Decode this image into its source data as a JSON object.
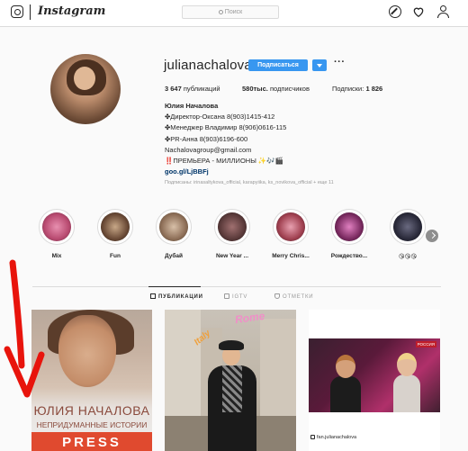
{
  "topbar": {
    "wordmark": "Instagram",
    "search_placeholder": "Поиск"
  },
  "profile": {
    "username": "julianachalova",
    "follow_label": "Подписаться",
    "more_label": "···",
    "stats": {
      "posts_value": "3 647",
      "posts_label": "публикаций",
      "followers_value": "580тыс.",
      "followers_label": "подписчиков",
      "following_label": "Подписки:",
      "following_value": "1 826"
    },
    "bio": {
      "full_name": "Юлия Началова",
      "line1": "✤Директор-Оксана 8(903)1415-412",
      "line2": "✤Менеджер Владимир 8(906)0616-115",
      "line3": "✤PR-Анна 8(903)6196-600",
      "line4": "Nachalovagroup@gmail.com",
      "line5": "‼️ПРЕМЬЕРА - МИЛЛИОНЫ ✨🎶🎬",
      "link": "goo.gl/LjBBFj"
    },
    "followed_by": "Подписаны: irinasaltykova_official, karapyiika, ks_novikova_official + еще 11"
  },
  "highlights": [
    {
      "label": "Mix",
      "color": "#b84a70"
    },
    {
      "label": "Fun",
      "color": "#6a4a36"
    },
    {
      "label": "Дубай",
      "color": "#8e6f58"
    },
    {
      "label": "New Year ...",
      "color": "#5a3a3a"
    },
    {
      "label": "Merry Chris...",
      "color": "#a04050"
    },
    {
      "label": "Рождество...",
      "color": "#7a2a60"
    },
    {
      "label": "😘😘😘",
      "color": "#2a2a3a"
    }
  ],
  "tabs": {
    "posts": "ПУБЛИКАЦИИ",
    "igtv": "IGTV",
    "tagged": "ОТМЕТКИ"
  },
  "posts": {
    "post1_title": "ЮЛИЯ НАЧАЛОВА",
    "post1_subtitle": "НЕПРИДУМАННЫЕ ИСТОРИИ",
    "post1_banner": "PRESS",
    "post2_rome": "Rome",
    "post2_italy": "Italy",
    "post3_badge": "РОССИЯ",
    "post3_credit": "fan.julianachalova"
  },
  "colors": {
    "accent": "#3897f0",
    "annotation": "#e8140c"
  }
}
